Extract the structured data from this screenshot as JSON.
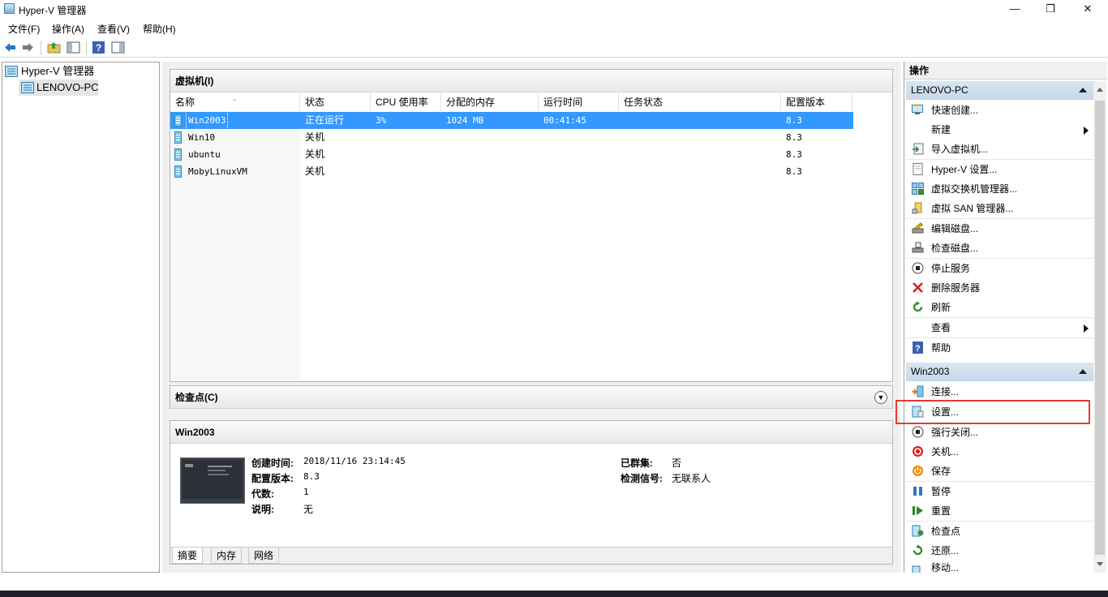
{
  "window": {
    "title": "Hyper-V 管理器",
    "minimize": "—",
    "maximize": "❐",
    "close": "✕"
  },
  "menu": [
    "文件(F)",
    "操作(A)",
    "查看(V)",
    "帮助(H)"
  ],
  "tree": {
    "root": "Hyper-V 管理器",
    "child": "LENOVO-PC"
  },
  "vms": {
    "title": "虚拟机(I)",
    "columns": [
      "名称",
      "状态",
      "CPU 使用率",
      "分配的内存",
      "运行时间",
      "任务状态",
      "配置版本"
    ],
    "rows": [
      {
        "name": "Win2003",
        "state": "正在运行",
        "cpu": "3%",
        "mem": "1024 MB",
        "uptime": "00:41:45",
        "task": "",
        "version": "8.3"
      },
      {
        "name": "Win10",
        "state": "关机",
        "cpu": "",
        "mem": "",
        "uptime": "",
        "task": "",
        "version": "8.3"
      },
      {
        "name": "ubuntu",
        "state": "关机",
        "cpu": "",
        "mem": "",
        "uptime": "",
        "task": "",
        "version": "8.3"
      },
      {
        "name": "MobyLinuxVM",
        "state": "关机",
        "cpu": "",
        "mem": "",
        "uptime": "",
        "task": "",
        "version": "8.3"
      }
    ]
  },
  "checkpoints": {
    "title": "检查点(C)"
  },
  "details": {
    "title": "Win2003",
    "created_label": "创建时间:",
    "created": "2018/11/16 23:14:45",
    "config_label": "配置版本:",
    "config": "8.3",
    "gen_label": "代数:",
    "gen": "1",
    "desc_label": "说明:",
    "desc": "无",
    "cluster_label": "已群集:",
    "cluster": "否",
    "heartbeat_label": "检测信号:",
    "heartbeat": "无联系人",
    "tabs": [
      "摘要",
      "内存",
      "网络"
    ]
  },
  "actions": {
    "title": "操作",
    "group1": "LENOVO-PC",
    "group1_items": [
      "快速创建...",
      "新建",
      "导入虚拟机...",
      "Hyper-V 设置...",
      "虚拟交换机管理器...",
      "虚拟 SAN 管理器...",
      "编辑磁盘...",
      "检查磁盘...",
      "停止服务",
      "删除服务器",
      "刷新",
      "查看",
      "帮助"
    ],
    "group2": "Win2003",
    "group2_items": [
      "连接...",
      "设置...",
      "强行关闭...",
      "关机...",
      "保存",
      "暂停",
      "重置",
      "检查点",
      "还原...",
      "移动..."
    ]
  },
  "colors": {
    "selection": "#3399ff",
    "highlight_border": "#e53935",
    "group_header": "#c9dbec"
  }
}
